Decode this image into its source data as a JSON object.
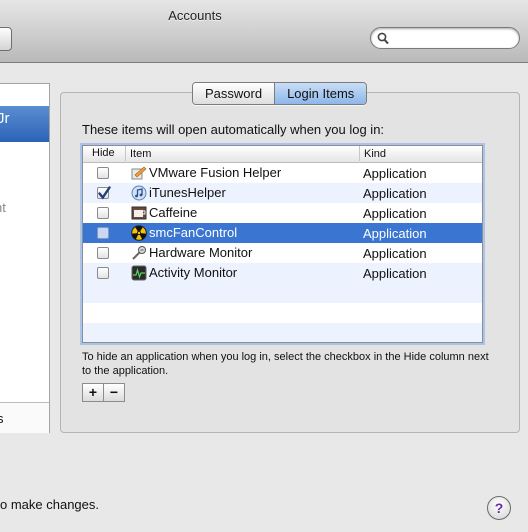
{
  "window": {
    "title": "Accounts"
  },
  "search": {
    "placeholder": "",
    "value": ""
  },
  "sidebar": {
    "selected_fragment": "Jr",
    "gray_fragment": "nt",
    "footer_fragment": "s"
  },
  "tabs": [
    {
      "label": "Password",
      "active": false
    },
    {
      "label": "Login Items",
      "active": true
    }
  ],
  "login_items": {
    "intro": "These items will open automatically when you log in:",
    "columns": {
      "hide": "Hide",
      "item": "Item",
      "kind": "Kind"
    },
    "rows": [
      {
        "hide": false,
        "name": "VMware Fusion Helper",
        "kind": "Application",
        "icon": "vmware-icon",
        "selected": false
      },
      {
        "hide": true,
        "name": "iTunesHelper",
        "kind": "Application",
        "icon": "itunes-icon",
        "selected": false
      },
      {
        "hide": false,
        "name": "Caffeine",
        "kind": "Application",
        "icon": "caffeine-icon",
        "selected": false
      },
      {
        "hide": false,
        "name": "smcFanControl",
        "kind": "Application",
        "icon": "fan-icon",
        "selected": true
      },
      {
        "hide": false,
        "name": "Hardware Monitor",
        "kind": "Application",
        "icon": "hardware-monitor-icon",
        "selected": false
      },
      {
        "hide": false,
        "name": "Activity Monitor",
        "kind": "Application",
        "icon": "activity-monitor-icon",
        "selected": false
      }
    ],
    "hint": "To hide an application when you log in, select the checkbox in the Hide column next to the application.",
    "add_label": "+",
    "remove_label": "−"
  },
  "footer": {
    "lock_text": "o make changes.",
    "help_label": "?"
  },
  "colors": {
    "selection": "#3a75d1",
    "alt_row": "#edf3fe",
    "active_tab": "#8db7ea"
  }
}
